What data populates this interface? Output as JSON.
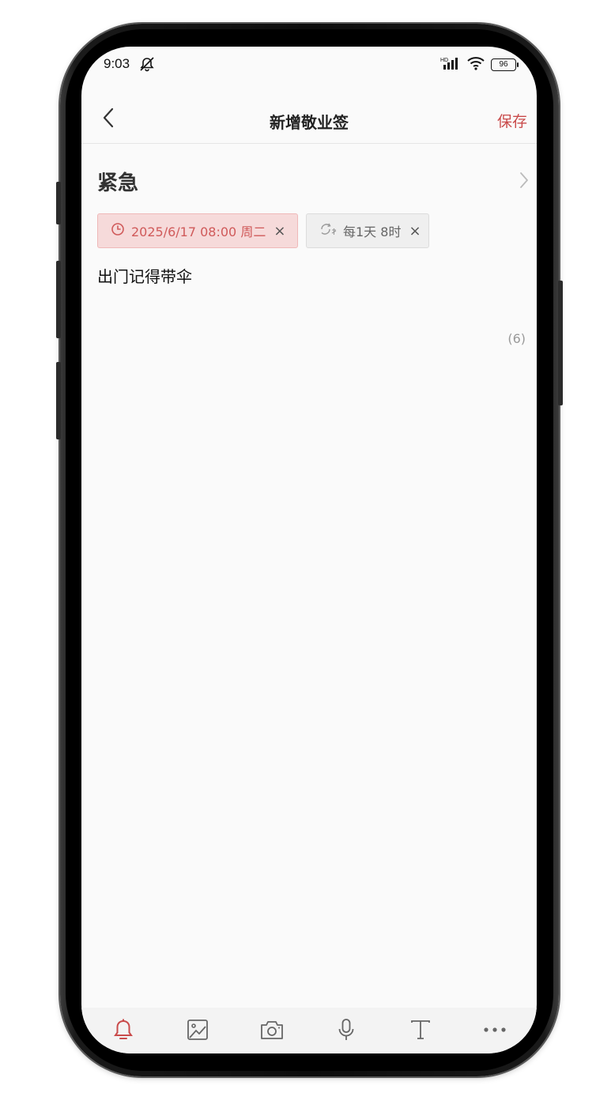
{
  "status_bar": {
    "time": "9:03",
    "battery": "96",
    "icons": [
      "mute-icon",
      "hd-signal-icon",
      "wifi-icon",
      "battery-icon"
    ]
  },
  "nav": {
    "title": "新增敬业签",
    "save_label": "保存",
    "back_icon": "chevron-left-icon"
  },
  "category": {
    "label": "紧急",
    "chevron_icon": "chevron-right-icon"
  },
  "chips": {
    "date": {
      "text": "2025/6/17 08:00 周二",
      "icon": "clock-icon",
      "close": "×"
    },
    "repeat": {
      "text": "每1天 8时",
      "icon": "repeat-icon",
      "close": "×"
    }
  },
  "note": {
    "content": "出门记得带伞",
    "char_count": "(6)"
  },
  "toolbar": {
    "items": [
      {
        "name": "reminder",
        "icon": "bell-icon",
        "active": true
      },
      {
        "name": "image",
        "icon": "image-icon",
        "active": false
      },
      {
        "name": "camera",
        "icon": "camera-icon",
        "active": false
      },
      {
        "name": "voice",
        "icon": "microphone-icon",
        "active": false
      },
      {
        "name": "text-format",
        "icon": "text-icon",
        "active": false
      },
      {
        "name": "more",
        "icon": "more-icon",
        "active": false
      }
    ]
  },
  "colors": {
    "accent": "#c94b4b",
    "date_chip_bg": "#f6dada",
    "repeat_chip_bg": "#efefef",
    "screen_bg": "#fafafa",
    "toolbar_bg": "#f3f3f3"
  }
}
